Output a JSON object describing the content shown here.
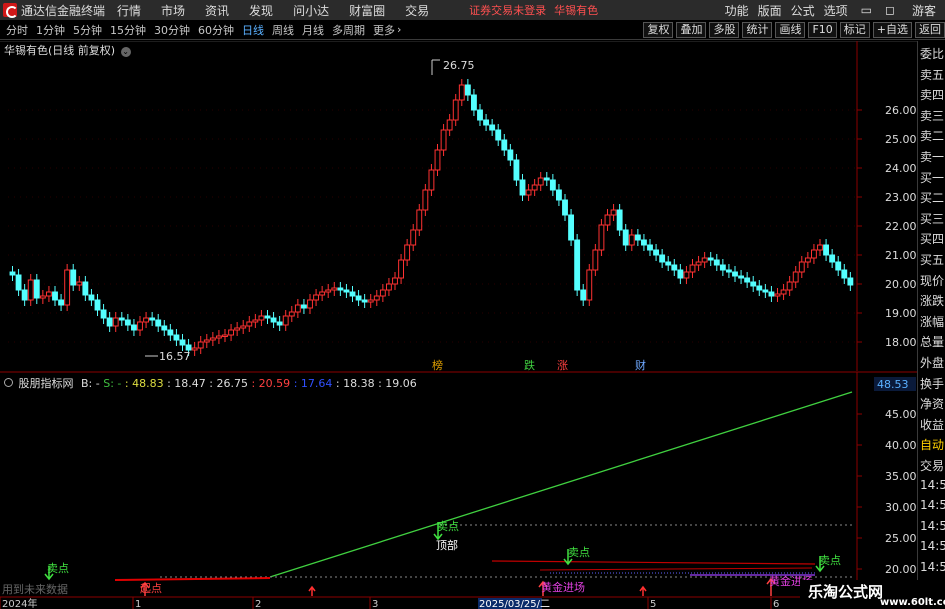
{
  "titlebar": {
    "app_title": "通达信金融终端",
    "menu": [
      "行情",
      "市场",
      "资讯",
      "发现",
      "问小达",
      "财富圈",
      "交易"
    ],
    "notice": "证券交易未登录",
    "stock_name": "华锡有色",
    "right_menu": [
      "功能",
      "版面",
      "公式",
      "选项"
    ],
    "guest": "游客"
  },
  "periods": [
    {
      "label": "分时"
    },
    {
      "label": "1分钟"
    },
    {
      "label": "5分钟"
    },
    {
      "label": "15分钟"
    },
    {
      "label": "30分钟"
    },
    {
      "label": "60分钟"
    },
    {
      "label": "日线",
      "active": true
    },
    {
      "label": "周线"
    },
    {
      "label": "月线"
    },
    {
      "label": "多周期"
    },
    {
      "label": "更多"
    }
  ],
  "toolbar": [
    "复权",
    "叠加",
    "多股",
    "统计",
    "画线",
    "F10",
    "标记",
    "+自选",
    "返回"
  ],
  "main_chart": {
    "title": "华锡有色(日线 前复权)",
    "high_label": "26.75",
    "low_label": "16.57",
    "price_ticks": [
      "26.00",
      "25.00",
      "24.00",
      "23.00",
      "22.00",
      "21.00",
      "20.00",
      "19.00",
      "18.00"
    ],
    "event_markers": [
      {
        "text": "榜",
        "color": "#e0a000"
      },
      {
        "text": "跌",
        "color": "#40d040"
      },
      {
        "text": "涨",
        "color": "#ff4040"
      },
      {
        "text": "财",
        "color": "#6fa8ff"
      }
    ]
  },
  "indicator": {
    "name": "股朋指标网",
    "prefix": "B: -",
    "values": [
      {
        "text": "S: -",
        "color": "#40c040"
      },
      {
        "text": ": 48.83",
        "color": "#dddd40"
      },
      {
        "text": ": 18.47",
        "color": "#ddd"
      },
      {
        "text": ": 26.75",
        "color": "#ddd"
      },
      {
        "text": ": 20.59",
        "color": "#ff4040"
      },
      {
        "text": ": 17.64",
        "color": "#3050ff"
      },
      {
        "text": ": 18.38",
        "color": "#ddd"
      },
      {
        "text": ": 19.06",
        "color": "#ddd"
      }
    ],
    "current_value": "48.53",
    "ticks": [
      "45.00",
      "40.00",
      "35.00",
      "30.00",
      "25.00",
      "20.00"
    ],
    "signals": [
      {
        "text": "卖点",
        "color": "#40e040"
      },
      {
        "text": "顶部",
        "color": "#ffffff"
      },
      {
        "text": "卖点",
        "color": "#40e040"
      },
      {
        "text": "卖点",
        "color": "#40e040"
      },
      {
        "text": "卖点",
        "color": "#40e040"
      },
      {
        "text": "黄金进场",
        "color": "#e040e0"
      },
      {
        "text": "黄金进场",
        "color": "#e040e0"
      },
      {
        "text": "起点",
        "color": "#ff4040"
      }
    ],
    "future_data_note": "用到未来数据"
  },
  "time_axis": [
    "2024年",
    "1",
    "2",
    "3",
    "2025/03/25/二",
    "5",
    "6"
  ],
  "side_panel": {
    "labels": [
      "委比",
      "卖五",
      "卖四",
      "卖三",
      "卖二",
      "卖一",
      "买一",
      "买二",
      "买三",
      "买四",
      "买五",
      "现价",
      "涨跌",
      "涨幅",
      "总量",
      "外盘",
      "换手",
      "净资",
      "收益",
      "自动",
      "交易",
      "14:56",
      "14:56",
      "14:56",
      "14:56",
      "14:56",
      "14:56",
      "14:56",
      "14:56"
    ]
  },
  "watermark": {
    "cn": "乐淘公式网",
    "url": "www.60lt.com"
  },
  "colors": {
    "up": "#ff3232",
    "down": "#54ffff",
    "accent": "#5ab0ff",
    "grid": "#8b0000"
  }
}
